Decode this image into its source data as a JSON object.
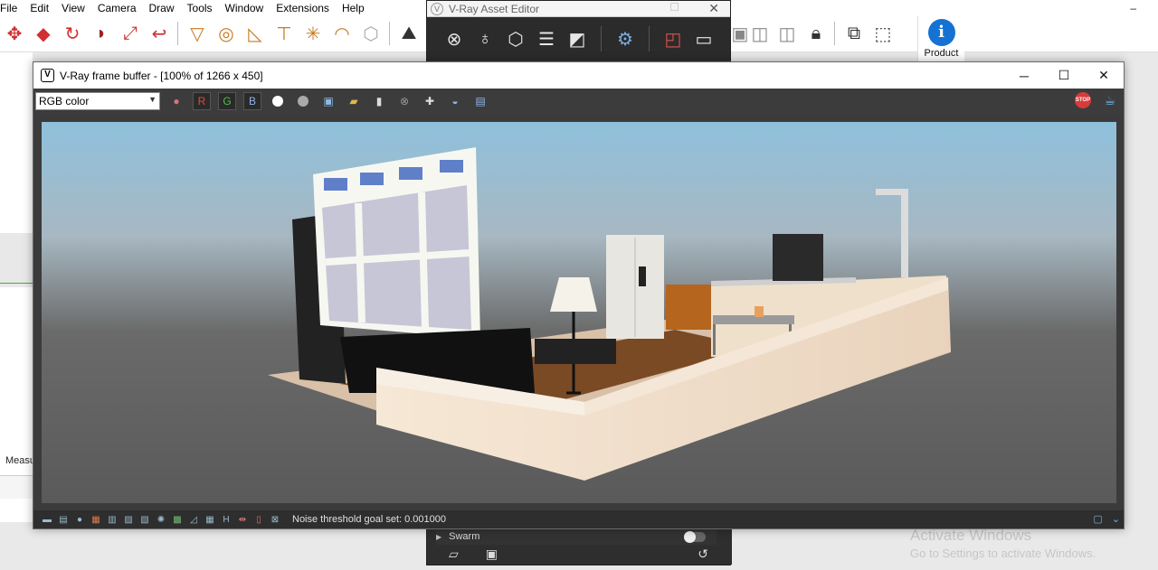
{
  "sketchup": {
    "menu": [
      "File",
      "Edit",
      "View",
      "Camera",
      "Draw",
      "Tools",
      "Window",
      "Extensions",
      "Help"
    ],
    "window_dash": "–",
    "product_label": "Product",
    "info_icon_glyph": "i",
    "measure_label": "Measu",
    "colors": {
      "accent_blue": "#1572d3",
      "tool_red": "#d03030"
    }
  },
  "asset_editor": {
    "title": "V-Ray Asset Editor",
    "close_glyph": "✕",
    "swarm_label": "Swarm",
    "icons": [
      "settings-icon",
      "light-icon",
      "geometry-icon",
      "layers-icon",
      "render-elements-icon",
      "gear-icon",
      "render-interactive-icon",
      "frame-buffer-icon"
    ]
  },
  "vfb": {
    "title": "V-Ray frame buffer - [100% of 1266 x 450]",
    "minimize_glyph": "─",
    "maximize_glyph": "☐",
    "close_glyph": "✕",
    "channel": "RGB color",
    "channel_buttons": {
      "r": "R",
      "g": "G",
      "b": "B"
    },
    "colors": {
      "r": "#e04a3a",
      "g": "#4fbf4a",
      "b": "#5a8fe0"
    },
    "stop_label": "STOP",
    "status_text": "Noise threshold goal set: 0.001000"
  },
  "watermark": {
    "title": "Activate Windows",
    "subtitle": "Go to Settings to activate Windows."
  }
}
